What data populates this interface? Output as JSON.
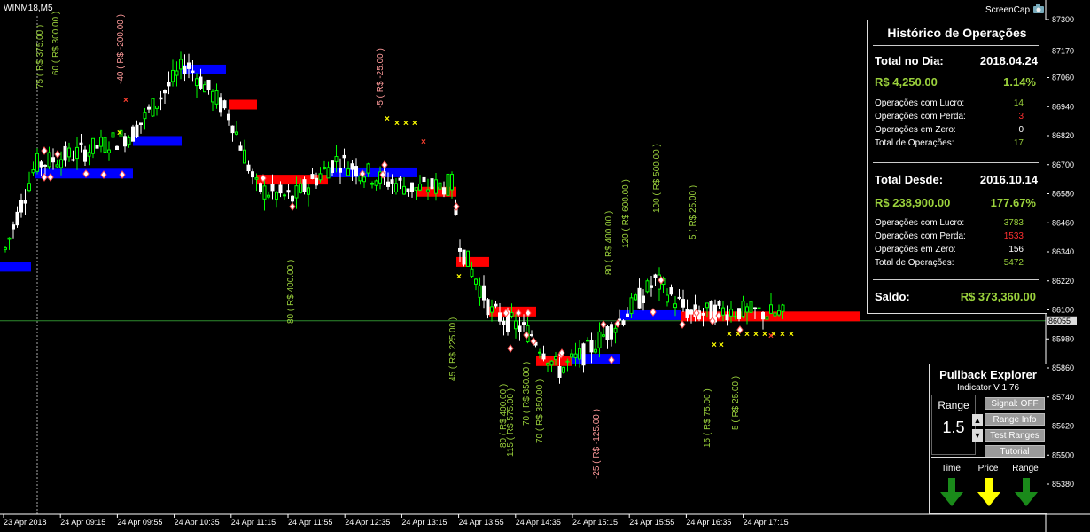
{
  "window": {
    "symbol": "WINM18,M5",
    "watermark": "ScreenCap"
  },
  "price_axis": {
    "ticks": [
      "87300",
      "87170",
      "87060",
      "86940",
      "86820",
      "86700",
      "86580",
      "86460",
      "86340",
      "86220",
      "86100",
      "85980",
      "85860",
      "85740",
      "85620",
      "85500",
      "85380"
    ],
    "current_price": "86055"
  },
  "time_axis": {
    "labels": [
      "23 Apr 2018",
      "24 Apr 09:15",
      "24 Apr 09:55",
      "24 Apr 10:35",
      "24 Apr 11:15",
      "24 Apr 11:55",
      "24 Apr 12:35",
      "24 Apr 13:15",
      "24 Apr 13:55",
      "24 Apr 14:35",
      "24 Apr 15:15",
      "24 Apr 15:55",
      "24 Apr 16:35",
      "24 Apr 17:15"
    ]
  },
  "trade_annotations": [
    {
      "text": "75 ( R$ 375.00 )",
      "color": "#9bd23c"
    },
    {
      "text": "60 ( R$ 300.00 )",
      "color": "#9bd23c"
    },
    {
      "text": "-40 ( R$ -200.00 )",
      "color": "#ff9a9a"
    },
    {
      "text": "-5 ( R$ -25.00 )",
      "color": "#ff9a9a"
    },
    {
      "text": "80 ( R$ 400.00 )",
      "color": "#9bd23c"
    },
    {
      "text": "45 ( R$ 225.00 )",
      "color": "#9bd23c"
    },
    {
      "text": "80 ( R$ 400.00 )",
      "color": "#9bd23c"
    },
    {
      "text": "115 ( R$ 575.00 )",
      "color": "#9bd23c"
    },
    {
      "text": "70 ( R$ 350.00 )",
      "color": "#9bd23c"
    },
    {
      "text": "70 ( R$ 350.00 )",
      "color": "#9bd23c"
    },
    {
      "text": "-25 ( R$ -125.00 )",
      "color": "#ff9a9a"
    },
    {
      "text": "80 ( R$ 400.00 )",
      "color": "#9bd23c"
    },
    {
      "text": "120 ( R$ 600.00 )",
      "color": "#9bd23c"
    },
    {
      "text": "100 ( R$ 500.00 )",
      "color": "#9bd23c"
    },
    {
      "text": "5 ( R$ 25.00 )",
      "color": "#9bd23c"
    },
    {
      "text": "15 ( R$ 75.00 )",
      "color": "#9bd23c"
    },
    {
      "text": "5 ( R$ 25.00 )",
      "color": "#9bd23c"
    }
  ],
  "history": {
    "title": "Histórico de Operações",
    "day": {
      "label": "Total no Dia:",
      "date": "2018.04.24",
      "amount": "R$ 4,250.00",
      "percent": "1.14%",
      "rows": [
        {
          "label": "Operações com Lucro:",
          "value": "14",
          "color": "#9bd23c"
        },
        {
          "label": "Operações com Perda:",
          "value": "3",
          "color": "#ff3030"
        },
        {
          "label": "Operações em Zero:",
          "value": "0",
          "color": "#ffffff"
        },
        {
          "label": "Total de Operações:",
          "value": "17",
          "color": "#9bd23c"
        }
      ]
    },
    "since": {
      "label": "Total Desde:",
      "date": "2016.10.14",
      "amount": "R$ 238,900.00",
      "percent": "177.67%",
      "rows": [
        {
          "label": "Operações com Lucro:",
          "value": "3783",
          "color": "#9bd23c"
        },
        {
          "label": "Operações com Perda:",
          "value": "1533",
          "color": "#ff3030"
        },
        {
          "label": "Operações em Zero:",
          "value": "156",
          "color": "#ffffff"
        },
        {
          "label": "Total de Operações:",
          "value": "5472",
          "color": "#9bd23c"
        }
      ]
    },
    "balance_label": "Saldo:",
    "balance_value": "R$ 373,360.00"
  },
  "pullback": {
    "title": "Pullback Explorer",
    "subtitle": "Indicator V 1.76",
    "range_label": "Range",
    "range_value": "1.5",
    "up_glyph": "▲",
    "down_glyph": "▼",
    "buttons": {
      "signal": "Signal: OFF",
      "range_info": "Range Info",
      "test_ranges": "Test Ranges",
      "tutorial": "Tutorial"
    },
    "indicators": [
      {
        "label": "Time",
        "color": "#1a8a1a"
      },
      {
        "label": "Price",
        "color": "#ffff00"
      },
      {
        "label": "Range",
        "color": "#1a8a1a"
      }
    ]
  },
  "colors": {
    "bull_candle": "#00ff00",
    "bear_candle": "#ffffff",
    "band_up": "#0000ff",
    "band_down": "#ff0000",
    "price_line": "#2e8b2e",
    "marker_x": "#ffff00"
  }
}
